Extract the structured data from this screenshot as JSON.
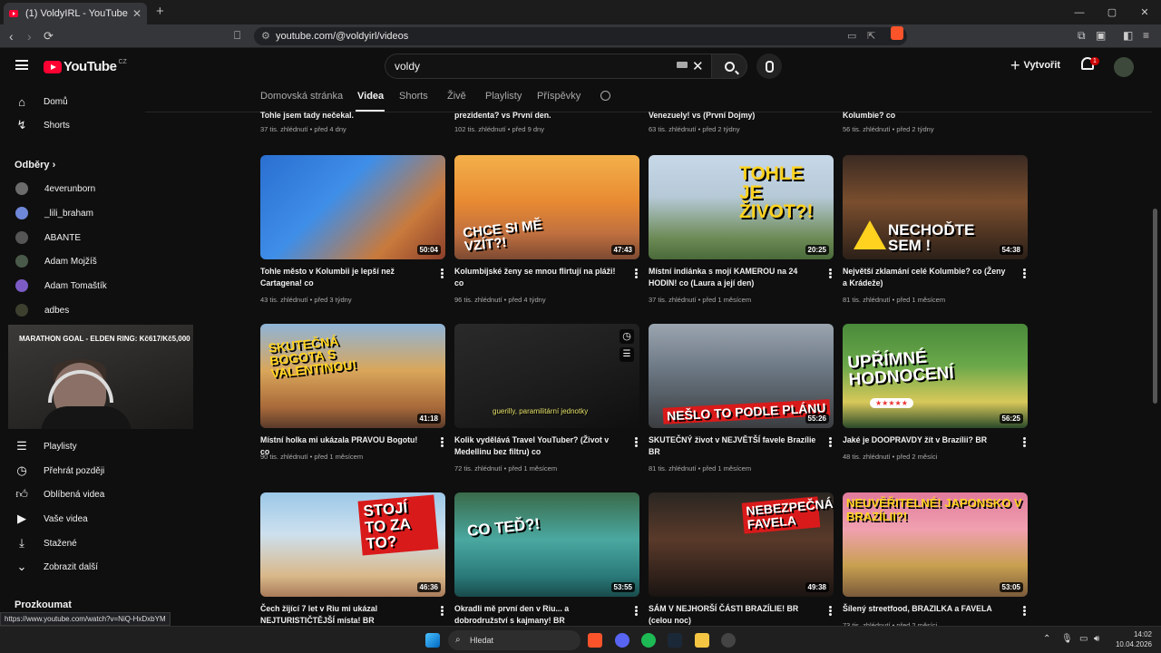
{
  "browser": {
    "tab_title": "(1) VoldyIRL - YouTube",
    "tab_close": "✕",
    "new_tab": "+",
    "url": "youtube.com/@voldyirl/videos",
    "window_controls": [
      "—",
      "▢",
      "✕"
    ]
  },
  "youtube": {
    "logo_text": "YouTube",
    "country_code": "CZ",
    "search_value": "voldy",
    "create_label": "Vytvořit",
    "notif_count": "1"
  },
  "channel_tabs": [
    "Domovská stránka",
    "Videa",
    "Shorts",
    "Živě",
    "Playlisty",
    "Příspěvky"
  ],
  "sidebar": {
    "main": [
      {
        "label": "Domů",
        "icon": "home-icon"
      },
      {
        "label": "Shorts",
        "icon": "shorts-icon"
      }
    ],
    "subs_title": "Odběry",
    "subs": [
      {
        "label": "4everunborn",
        "color": "#6b6b6b"
      },
      {
        "label": "_lili_braham",
        "color": "#6f87d8"
      },
      {
        "label": "ABANTE",
        "color": "#555"
      },
      {
        "label": "Adam Mojžíš",
        "color": "#4a5a4a"
      },
      {
        "label": "Adam Tomaštík",
        "color": "#7c5cc4"
      },
      {
        "label": "adbes",
        "color": "#3d3f2f"
      }
    ],
    "you": [
      {
        "label": "Playlisty",
        "icon": "playlist-icon"
      },
      {
        "label": "Přehrát později",
        "icon": "clock-icon"
      },
      {
        "label": "Oblíbená videa",
        "icon": "thumb-up-icon"
      },
      {
        "label": "Vaše videa",
        "icon": "video-icon"
      },
      {
        "label": "Stažené",
        "icon": "download-icon"
      },
      {
        "label": "Zobrazit další",
        "icon": "chevron-down-icon"
      }
    ],
    "explore_title": "Prozkoumat"
  },
  "pip_title": "MARATHON GOAL - ELDEN RING: Kč617/Kč5,000",
  "top_row": [
    {
      "title": "Tohle jsem tady nečekal.",
      "meta": "37 tis. zhlédnutí • před 4 dny"
    },
    {
      "title": "prezidenta? vs První den.",
      "meta": "102 tis. zhlédnutí • před 9 dny"
    },
    {
      "title": "Venezuely! vs (První Dojmy)",
      "meta": "63 tis. zhlédnutí • před 2 týdny"
    },
    {
      "title": "Kolumbie? co",
      "meta": "56 tis. zhlédnutí • před 2 týdny"
    }
  ],
  "videos": [
    {
      "title": "Tohle město v Kolumbii je lepší než Cartagena! co",
      "meta": "43 tis. zhlédnutí • před 3 týdny",
      "duration": "50:04",
      "overlay": "",
      "bg": "linear-gradient(135deg,#2a6fd0 0%,#3f8ee8 40%,#c97a3c 75%,#8a3e2a 100%)"
    },
    {
      "title": "Kolumbijské ženy se mnou flirtují na pláži! co",
      "meta": "96 tis. zhlédnutí • před 4 týdny",
      "duration": "47:43",
      "overlay": "CHCE SI MĚ VZÍT?!",
      "bg": "linear-gradient(180deg,#f3b04a 0%,#e88a32 45%,#c0703f 75%,#7d4a32 100%)"
    },
    {
      "title": "Místní indiánka s mojí KAMEROU na 24 HODIN! co (Laura a její den)",
      "meta": "37 tis. zhlédnutí • před 1 měsícem",
      "duration": "20:25",
      "overlay": "TOHLE JE ŽIVOT?!",
      "bg": "linear-gradient(180deg,#c7d8e8 0%,#b6c9d7 40%,#6c8a55 80%,#4a6a3a 100%)"
    },
    {
      "title": "Největší zklamání celé Kolumbie? co (Ženy a Krádeže)",
      "meta": "81 tis. zhlédnutí • před 1 měsícem",
      "duration": "54:38",
      "overlay": "NECHOĎTE SEM !",
      "bg": "linear-gradient(180deg,#3a2a22 0%,#7a4e2e 45%,#2c2018 100%)"
    },
    {
      "title": "Místní holka mi ukázala PRAVOU Bogotu! co",
      "meta": "90 tis. zhlédnutí • před 1 měsícem",
      "duration": "41:18",
      "overlay": "SKUTEČNÁ BOGOTA S VALENTINOU!",
      "bg": "linear-gradient(180deg,#8fb4d8 0%,#d9a65a 45%,#a86a3a 80%,#5a3a2a 100%)"
    },
    {
      "title": "Kolik vydělává Travel YouTuber? (Život v Medellinu bez filtru) co",
      "meta": "72 tis. zhlédnutí • před 1 měsícem",
      "duration": "",
      "overlay": "guerilly, paramilitární jednotky",
      "bg": "linear-gradient(160deg,#2a2a2a 0%,#1e1e1e 50%,#0f0f0f 100%)"
    },
    {
      "title": "SKUTEČNÝ život v NEJVĚTŠÍ favele Brazílie BR",
      "meta": "81 tis. zhlédnutí • před 1 měsícem",
      "duration": "55:26",
      "overlay": "NEŠLO TO PODLE PLÁNU",
      "bg": "linear-gradient(180deg,#9aa5b0 0%,#6a7682 45%,#3b3d40 100%)"
    },
    {
      "title": "Jaké je DOOPRAVDY žít v Brazílii? BR",
      "meta": "48 tis. zhlédnutí • před 2 měsíci",
      "duration": "56:25",
      "overlay": "UPŘÍMNÉ HODNOCENÍ",
      "bg": "linear-gradient(180deg,#4a8a3a 0%,#6aa84a 40%,#d8c85a 75%,#2a4a2a 100%)"
    },
    {
      "title": "Čech žijící 7 let v Riu mi ukázal NEJTURISTIČTĚJŠÍ místa! BR",
      "meta": "",
      "duration": "46:36",
      "overlay": "STOJÍ TO ZA TO?",
      "bg": "linear-gradient(180deg,#9cc8e8 0%,#cde0ee 40%,#d9b88a 80%,#a87a5a 100%)"
    },
    {
      "title": "Okradli mě první den v Riu... a dobrodružství s kajmany! BR",
      "meta": "",
      "duration": "53:55",
      "overlay": "CO TEĎ?!",
      "bg": "linear-gradient(180deg,#3a6a4a 0%,#4aa8a0 45%,#2a7a7a 80%,#1a4a4a 100%)"
    },
    {
      "title": "SÁM V NEJHORŠÍ ČÁSTI BRAZÍLIE! BR (celou noc)",
      "meta": "",
      "duration": "49:38",
      "overlay": "NEBEZPEČNÁ FAVELA",
      "bg": "linear-gradient(180deg,#2a2622 0%,#5a3a2a 45%,#1a1412 100%)"
    },
    {
      "title": "Šílený streetfood, BRAZILKA a FAVELA",
      "meta": "73 tis. zhlédnutí • před 2 měsíci",
      "duration": "53:05",
      "overlay": "NEUVĚŘITELNÉ! JAPONSKO V BRAZÍLII?!",
      "bg": "linear-gradient(180deg,#e07a9a 0%,#f0a0b0 35%,#c8a050 70%,#7a5a3a 100%)"
    }
  ],
  "status_url": "https://www.youtube.com/watch?v=NiQ-HxDxbYM",
  "taskbar": {
    "search_placeholder": "Hledat",
    "time": "14:02",
    "date": "10.04.2026"
  }
}
